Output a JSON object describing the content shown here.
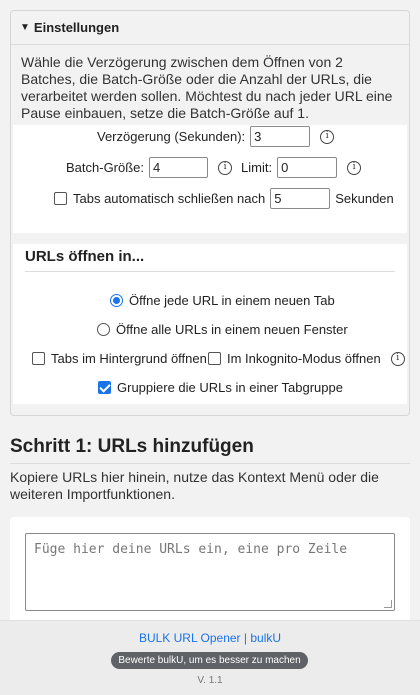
{
  "settings": {
    "title": "Einstellungen",
    "description": "Wähle die Verzögerung zwischen dem Öffnen von 2 Batches, die Batch-Größe oder die Anzahl der URLs, die verarbeitet werden sollen. Möchtest du nach jeder URL eine Pause einbauen, setze die Batch-Größe auf 1.",
    "delay_label": "Verzögerung (Sekunden):",
    "delay_value": "3",
    "batch_label": "Batch-Größe:",
    "batch_value": "4",
    "limit_label": "Limit:",
    "limit_value": "0",
    "autoclose_label": "Tabs automatisch schließen nach",
    "autoclose_value": "5",
    "autoclose_unit": "Sekunden",
    "autoclose_checked": false,
    "info_glyph": "i"
  },
  "open_in": {
    "title": "URLs öffnen in...",
    "option_new_tab": "Öffne jede URL in einem neuen Tab",
    "option_new_window": "Öffne alle URLs in einem neuen Fenster",
    "selected": "new_tab",
    "background_label": "Tabs im Hintergrund öffnen",
    "background_checked": false,
    "incognito_label": "Im Inkognito-Modus öffnen",
    "incognito_checked": false,
    "group_label": "Gruppiere die URLs in einer Tabgruppe",
    "group_checked": true
  },
  "step1": {
    "title": "Schritt 1: URLs hinzufügen",
    "description": "Kopiere URLs hier hinein, nutze das Kontext Menü oder die weiteren Importfunktionen.",
    "textarea_placeholder": "Füge hier deine URLs ein, eine pro Zeile"
  },
  "footer": {
    "link_text": "BULK URL Opener | bulkU",
    "rate_button": "Bewerte bulkU, um es besser zu machen",
    "version": "V. 1.1"
  },
  "colors": {
    "accent": "#1a73e8",
    "background": "#f2f2f2",
    "rate_button_bg": "#5f6266"
  }
}
